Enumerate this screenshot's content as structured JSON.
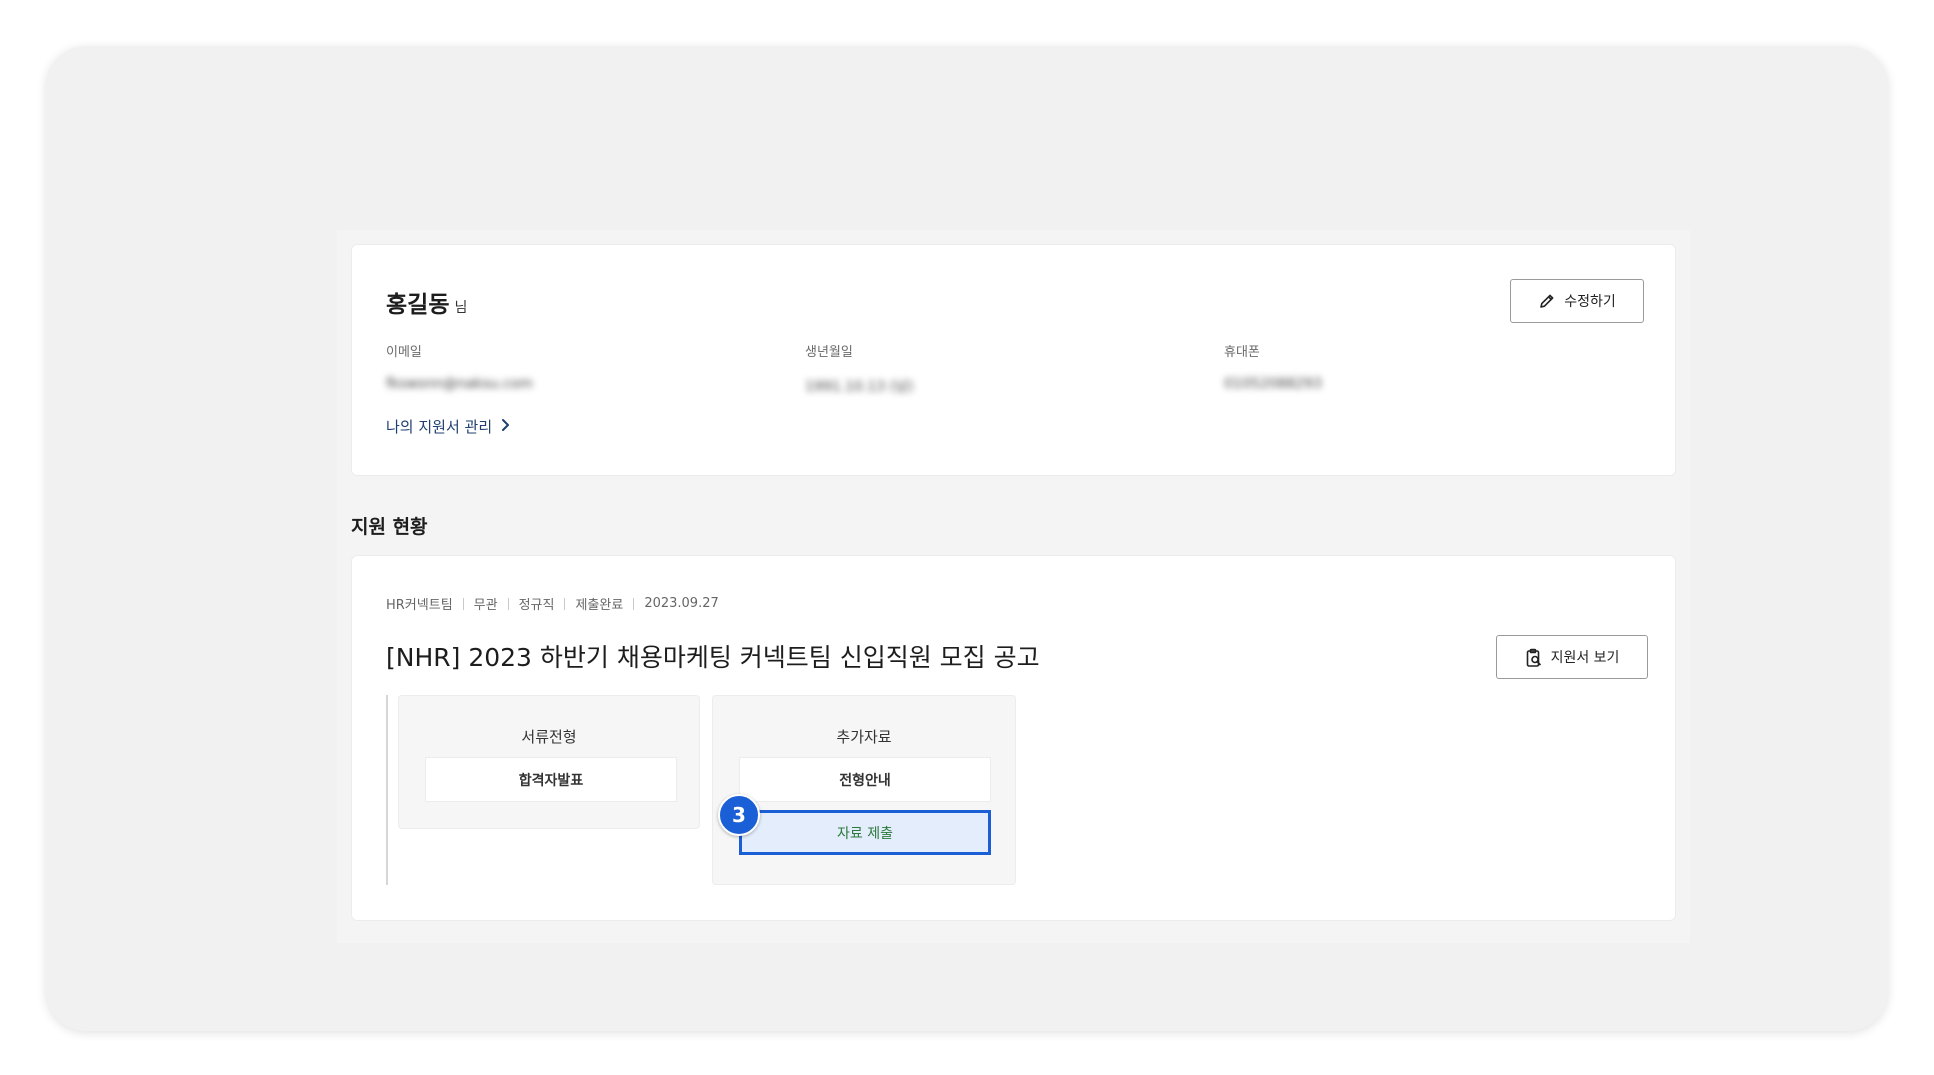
{
  "profile": {
    "name": "홍길동",
    "honorific": "님",
    "edit_label": "수정하기",
    "email_label": "이메일",
    "email_value": "fkswsnn@naksu.com",
    "birth_label": "생년월일",
    "birth_value": "1991.10.13 (남)",
    "phone_label": "휴대폰",
    "phone_value": "01052088293",
    "manage_link": "나의 지원서 관리"
  },
  "status": {
    "section_title": "지원 현황",
    "meta": [
      "HR커넥트팀",
      "무관",
      "정규직",
      "제출완료",
      "2023.09.27"
    ],
    "job_title": "[NHR] 2023 하반기 채용마케팅 커넥트팀 신입직원 모집 공고",
    "view_label": "지원서 보기",
    "stages": [
      {
        "title": "서류전형",
        "items": [
          "합격자발표"
        ]
      },
      {
        "title": "추가자료",
        "items": [
          "전형안내",
          "자료 제출"
        ]
      }
    ],
    "step_number": "3"
  },
  "colors": {
    "accent": "#1a5fd6",
    "link": "#1f3f6e",
    "submit_text": "#2b7a3b"
  },
  "icons": {
    "edit": "pencil-icon",
    "view": "clipboard-search-icon",
    "manage": "chevron-right-icon"
  }
}
